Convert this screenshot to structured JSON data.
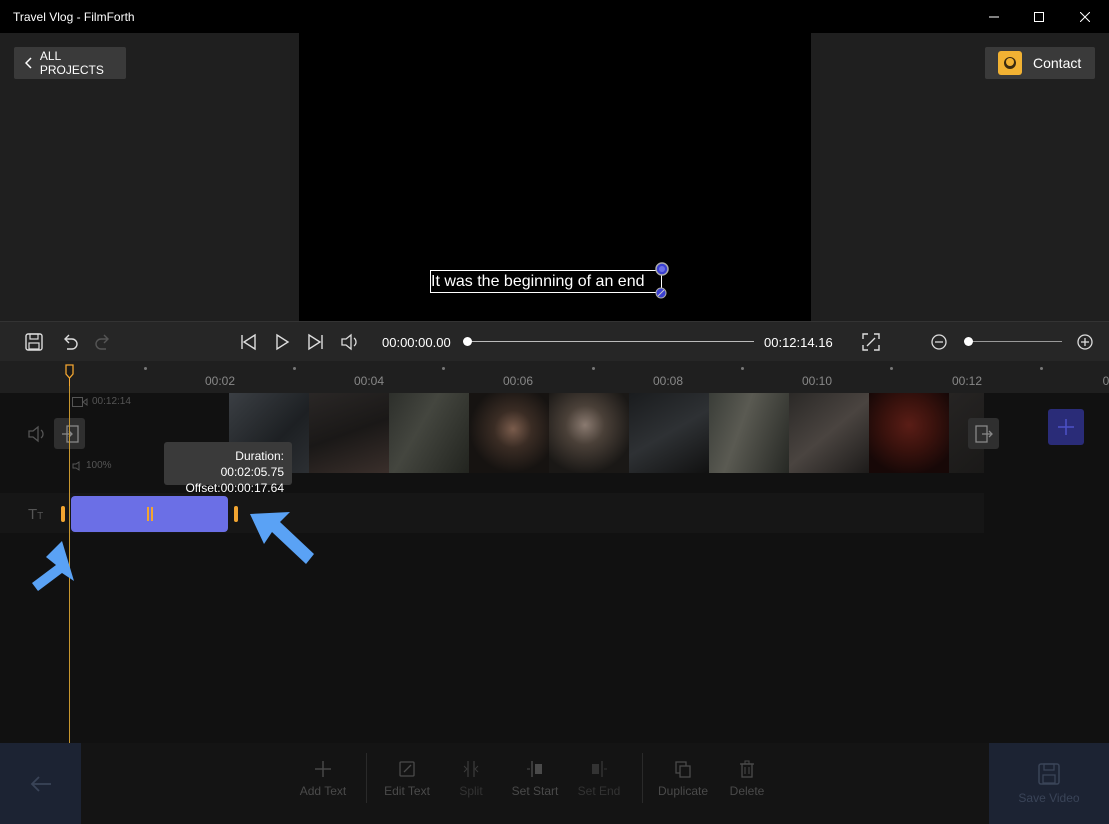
{
  "window": {
    "title": "Travel Vlog - FilmForth"
  },
  "header": {
    "all_projects_label": "ALL PROJECTS",
    "contact_label": "Contact"
  },
  "preview": {
    "caption": "It was the beginning of an end"
  },
  "player": {
    "current_time": "00:00:00.00",
    "total_time": "00:12:14.16",
    "progress": 0.0,
    "zoom_level": 0.0
  },
  "ruler": {
    "labels": [
      "00:02",
      "00:04",
      "00:06",
      "00:08",
      "00:10",
      "00:12",
      "0"
    ]
  },
  "video_track": {
    "duration": "00:12:14",
    "volume": "100%"
  },
  "text_clip": {
    "duration_line": "Duration: 00:02:05.75",
    "offset_line": "Offset:00:00:17.64"
  },
  "toolbar": {
    "add_text": "Add Text",
    "edit_text": "Edit Text",
    "split": "Split",
    "set_start": "Set Start",
    "set_end": "Set End",
    "duplicate": "Duplicate",
    "delete": "Delete",
    "save_video": "Save Video"
  },
  "colors": {
    "accent": "#6b6fe6",
    "handle": "#f2a531",
    "annotation_arrow": "#5aa2f5"
  }
}
